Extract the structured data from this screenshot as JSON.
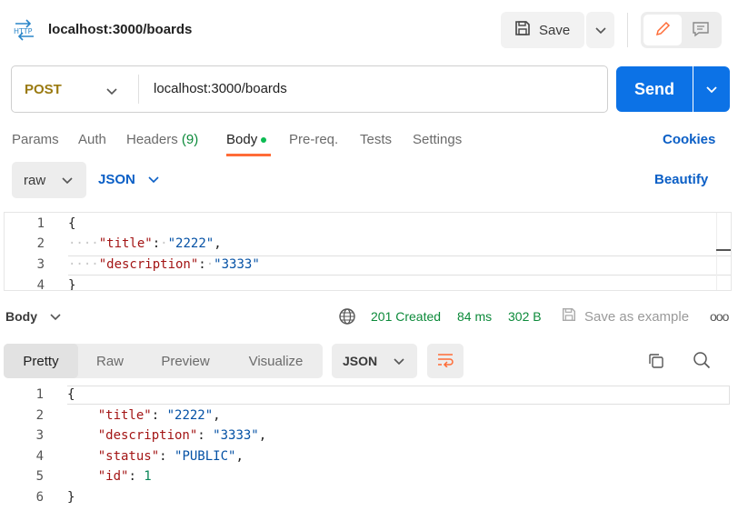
{
  "header": {
    "request_title": "localhost:3000/boards",
    "http_icon_label": "HTTP",
    "save_label": "Save",
    "icons": {
      "http": "http-icon",
      "save": "save-icon",
      "edit": "pencil-icon",
      "comment": "comment-icon"
    },
    "accent_color": "#ff6c37"
  },
  "url_bar": {
    "method": "POST",
    "method_color": "#9a7a10",
    "url": "localhost:3000/boards",
    "send_label": "Send",
    "send_color": "#0c72e6"
  },
  "request_tabs": {
    "params": "Params",
    "auth": "Auth",
    "headers": "Headers",
    "headers_count": "(9)",
    "body": "Body",
    "prereq": "Pre-req.",
    "tests": "Tests",
    "settings": "Settings",
    "cookies": "Cookies",
    "active": "Body"
  },
  "body_options": {
    "mode": "raw",
    "format": "JSON",
    "beautify": "Beautify"
  },
  "request_editor": {
    "line_numbers": [
      "1",
      "2",
      "3",
      "4"
    ],
    "lines": [
      {
        "open": "{"
      },
      {
        "key": "\"title\"",
        "value": "\"2222\"",
        "trail": ","
      },
      {
        "key": "\"description\"",
        "value": "\"3333\"",
        "trail": ""
      },
      {
        "close": "}"
      }
    ]
  },
  "response_bar": {
    "section": "Body",
    "status": "201 Created",
    "time": "84 ms",
    "size": "302 B",
    "save_example": "Save as example",
    "more": "ooo",
    "status_color": "#0c8a3a"
  },
  "response_view": {
    "tabs": [
      "Pretty",
      "Raw",
      "Preview",
      "Visualize"
    ],
    "active_tab": "Pretty",
    "format": "JSON"
  },
  "response_editor": {
    "line_numbers": [
      "1",
      "2",
      "3",
      "4",
      "5",
      "6"
    ],
    "lines": [
      {
        "open": "{"
      },
      {
        "key": "\"title\"",
        "value": "\"2222\"",
        "trail": ","
      },
      {
        "key": "\"description\"",
        "value": "\"3333\"",
        "trail": ","
      },
      {
        "key": "\"status\"",
        "value": "\"PUBLIC\"",
        "trail": ","
      },
      {
        "key": "\"id\"",
        "value": "1",
        "trail": ""
      },
      {
        "close": "}"
      }
    ]
  }
}
